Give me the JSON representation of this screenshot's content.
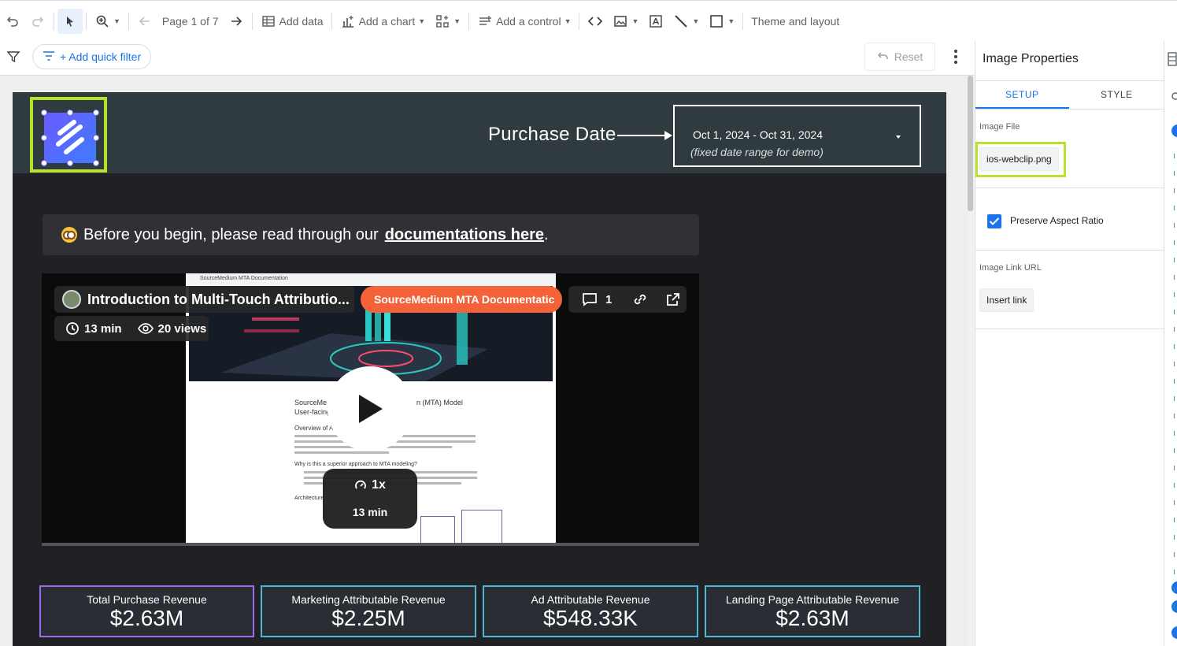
{
  "toolbar": {
    "page_indicator": "Page 1 of 7",
    "add_data": "Add data",
    "add_chart": "Add a chart",
    "add_control": "Add a control",
    "theme_layout": "Theme and layout"
  },
  "filterbar": {
    "quick_filter": "+ Add quick filter",
    "reset": "Reset"
  },
  "report": {
    "purchase_date_label": "Purchase Date",
    "date_range": "Oct 1, 2024 - Oct 31, 2024",
    "date_note": "(fixed date range for demo)",
    "notice_prefix": "Before you begin, please read through our",
    "notice_link": "documentations here",
    "notice_suffix": ".",
    "video": {
      "title": "Introduction to Multi-Touch Attributio...",
      "duration": "13 min",
      "views": "20 views",
      "channel_button": "SourceMedium MTA Documentatic",
      "comments": "1",
      "speed": "1x",
      "speed_duration": "13 min",
      "doc_topbar": "SourceMedium MTA Documentation",
      "doc_heading_1": "SourceMe",
      "doc_heading_2": "n (MTA) Model",
      "doc_heading_3": "User-facing",
      "doc_bullet": "Overview of Ap",
      "doc_question": "Why is this a superior approach to MTA modeling?",
      "doc_arch": "Architecture"
    },
    "kpis": [
      {
        "label": "Total Purchase Revenue",
        "value": "$2.63M",
        "border": "#9b6cf0"
      },
      {
        "label": "Marketing Attributable Revenue",
        "value": "$2.25M",
        "border": "#4fb8d9"
      },
      {
        "label": "Ad Attributable Revenue",
        "value": "$548.33K",
        "border": "#4fb8d9"
      },
      {
        "label": "Landing Page Attributable Revenue",
        "value": "$2.63M",
        "border": "#4fb8d9"
      }
    ]
  },
  "panel": {
    "title": "Image Properties",
    "tab_setup": "SETUP",
    "tab_style": "STYLE",
    "image_file_label": "Image File",
    "image_file_value": "ios-webclip.png",
    "preserve_aspect": "Preserve Aspect Ratio",
    "image_link_label": "Image Link URL",
    "insert_link": "Insert link"
  },
  "colors": {
    "accent": "#1a73e8",
    "highlight": "#b9e22a",
    "report_bg": "#202124",
    "header_bg": "#2f3b3e",
    "orange": "#f4623a"
  }
}
